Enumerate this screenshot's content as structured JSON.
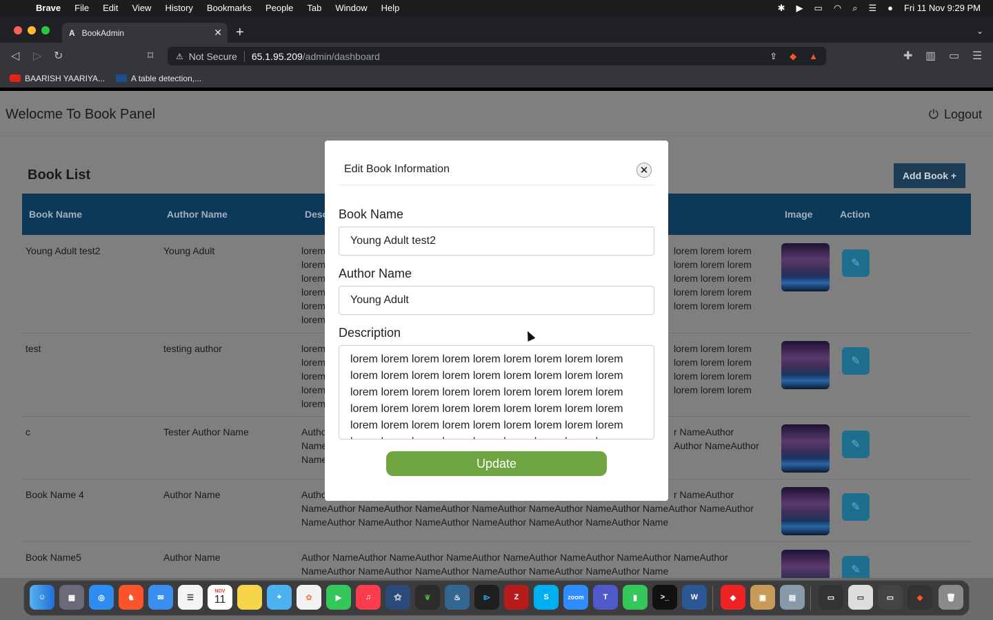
{
  "menubar": {
    "app": "Brave",
    "items": [
      "File",
      "Edit",
      "View",
      "History",
      "Bookmarks",
      "People",
      "Tab",
      "Window",
      "Help"
    ],
    "clock": "Fri 11 Nov  9:29 PM"
  },
  "browser": {
    "tab_title": "BookAdmin",
    "tab_favicon": "A",
    "security": "Not Secure",
    "url_host": "65.1.95.209",
    "url_path": "/admin/dashboard",
    "bookmarks": [
      "BAARISH YAARIYA...",
      "A table detection,..."
    ]
  },
  "page": {
    "header_title": "Welocme To Book Panel",
    "logout": "Logout",
    "list_title": "Book List",
    "add_button": "Add Book +",
    "columns": {
      "book": "Book Name",
      "author": "Author Name",
      "desc": "Desc",
      "image": "Image",
      "action": "Action"
    },
    "rows": [
      {
        "book": "Young Adult test2",
        "author": "Young Adult",
        "description": "lorem\nlorem\nlorem\nlorem\nlorem\nlorem",
        "description_right": "lorem lorem lorem\nlorem lorem lorem\nlorem lorem lorem\nlorem lorem lorem\nlorem lorem lorem"
      },
      {
        "book": "test",
        "author": "testing author",
        "description": "lorem\nlorem\nlorem\nlorem\nlorem",
        "description_right": "lorem lorem lorem\nlorem lorem lorem\nlorem lorem lorem\nlorem lorem lorem"
      },
      {
        "book": "c",
        "author": "Tester Author Name",
        "description": "Autho\nName\nName",
        "description_right": "r NameAuthor\nAuthor NameAuthor"
      },
      {
        "book": "Book Name 4",
        "author": "Author Name",
        "description": "Autho",
        "description_right": "r NameAuthor",
        "description_full": "NameAuthor NameAuthor NameAuthor NameAuthor NameAuthor NameAuthor NameAuthor NameAuthor\nNameAuthor NameAuthor NameAuthor NameAuthor NameAuthor NameAuthor Name"
      },
      {
        "book": "Book Name5",
        "author": "Author Name",
        "description_full": "Author NameAuthor NameAuthor NameAuthor NameAuthor NameAuthor NameAuthor NameAuthor\nNameAuthor NameAuthor NameAuthor NameAuthor NameAuthor NameAuthor Name"
      }
    ]
  },
  "modal": {
    "title": "Edit Book Information",
    "book_label": "Book Name",
    "book_value": "Young Adult test2",
    "author_label": "Author Name",
    "author_value": "Young Adult",
    "desc_label": "Description",
    "desc_value": "lorem lorem lorem lorem lorem lorem lorem lorem lorem\nlorem lorem lorem lorem lorem lorem lorem lorem lorem\nlorem lorem lorem lorem lorem lorem lorem lorem lorem\nlorem lorem lorem lorem lorem lorem lorem lorem lorem\nlorem lorem lorem lorem lorem lorem lorem lorem lorem\nlorem lorem lorem lorem lorem lorem lorem lorem lorem",
    "update_button": "Update"
  },
  "dock": {
    "calendar_month": "NOV",
    "calendar_day": "11",
    "zoom_label": "zoom"
  },
  "colors": {
    "header_bg": "#0e3858",
    "add_button_bg": "#1d3c55",
    "update_button": "#6ea541",
    "edit_button": "#1e6f8d"
  }
}
